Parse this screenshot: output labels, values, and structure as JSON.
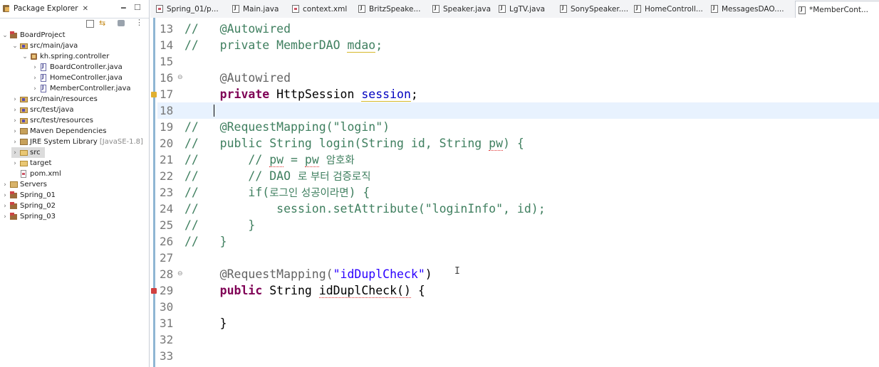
{
  "package_explorer": {
    "title": "Package Explorer",
    "tree": [
      {
        "label": "BoardProject"
      },
      {
        "label": "src/main/java"
      },
      {
        "label": "kh.spring.controller"
      },
      {
        "label": "BoardController.java"
      },
      {
        "label": "HomeController.java"
      },
      {
        "label": "MemberController.java"
      },
      {
        "label": "src/main/resources"
      },
      {
        "label": "src/test/java"
      },
      {
        "label": "src/test/resources"
      },
      {
        "label": "Maven Dependencies"
      },
      {
        "label": "JRE System Library",
        "extra": "[JavaSE-1.8]"
      },
      {
        "label": "src"
      },
      {
        "label": "target"
      },
      {
        "label": "pom.xml"
      },
      {
        "label": "Servers"
      },
      {
        "label": "Spring_01"
      },
      {
        "label": "Spring_02"
      },
      {
        "label": "Spring_03"
      }
    ]
  },
  "editor_tabs": [
    {
      "label": "Spring_01/p..."
    },
    {
      "label": "Main.java"
    },
    {
      "label": "context.xml"
    },
    {
      "label": "BritzSpeake..."
    },
    {
      "label": "Speaker.java"
    },
    {
      "label": "LgTV.java"
    },
    {
      "label": "SonySpeaker...."
    },
    {
      "label": "HomeControll..."
    },
    {
      "label": "MessagesDAO...."
    },
    {
      "label": "*MemberCont..."
    }
  ],
  "editor": {
    "lines": [
      {
        "n": "13",
        "segs": [
          {
            "t": "//   @Autowired",
            "c": "comment"
          }
        ]
      },
      {
        "n": "14",
        "segs": [
          {
            "t": "//   private MemberDAO ",
            "c": "comment"
          },
          {
            "t": "mdao",
            "c": "comment warn"
          },
          {
            "t": ";",
            "c": "comment"
          }
        ]
      },
      {
        "n": "15",
        "segs": []
      },
      {
        "n": "16",
        "segs": [
          {
            "t": "     @Autowired",
            "c": "anno"
          }
        ]
      },
      {
        "n": "17",
        "segs": [
          {
            "t": "     ",
            "c": ""
          },
          {
            "t": "private",
            "c": "kw"
          },
          {
            "t": " HttpSession ",
            "c": ""
          },
          {
            "t": "session",
            "c": "field warn"
          },
          {
            "t": ";",
            "c": ""
          }
        ]
      },
      {
        "n": "18",
        "segs": []
      },
      {
        "n": "19",
        "segs": [
          {
            "t": "//   @RequestMapping(\"login\")",
            "c": "comment"
          }
        ]
      },
      {
        "n": "20",
        "segs": [
          {
            "t": "//   public String login(String id, String ",
            "c": "comment"
          },
          {
            "t": "pw",
            "c": "comment err"
          },
          {
            "t": ") {",
            "c": "comment"
          }
        ]
      },
      {
        "n": "21",
        "segs": [
          {
            "t": "//       // ",
            "c": "comment"
          },
          {
            "t": "pw",
            "c": "comment err"
          },
          {
            "t": " = ",
            "c": "comment"
          },
          {
            "t": "pw",
            "c": "comment err"
          },
          {
            "t": " ",
            "c": "comment"
          },
          {
            "t": "암호화",
            "c": "comment kor"
          }
        ]
      },
      {
        "n": "22",
        "segs": [
          {
            "t": "//       // DAO ",
            "c": "comment"
          },
          {
            "t": "로 부터 검증로직",
            "c": "comment kor"
          }
        ]
      },
      {
        "n": "23",
        "segs": [
          {
            "t": "//       if(",
            "c": "comment"
          },
          {
            "t": "로그인 성공이라면",
            "c": "comment kor"
          },
          {
            "t": ") {",
            "c": "comment"
          }
        ]
      },
      {
        "n": "24",
        "segs": [
          {
            "t": "//           session.setAttribute(\"loginInfo\", id);",
            "c": "comment"
          }
        ]
      },
      {
        "n": "25",
        "segs": [
          {
            "t": "//       }",
            "c": "comment"
          }
        ]
      },
      {
        "n": "26",
        "segs": [
          {
            "t": "//   }",
            "c": "comment"
          }
        ]
      },
      {
        "n": "27",
        "segs": []
      },
      {
        "n": "28",
        "segs": [
          {
            "t": "     @RequestMapping(",
            "c": "anno"
          },
          {
            "t": "\"idDuplCheck\"",
            "c": "str"
          },
          {
            "t": ")",
            "c": ""
          }
        ]
      },
      {
        "n": "29",
        "segs": [
          {
            "t": "     ",
            "c": ""
          },
          {
            "t": "public",
            "c": "kw"
          },
          {
            "t": " String ",
            "c": ""
          },
          {
            "t": "idDuplCheck()",
            "c": "err"
          },
          {
            "t": " {",
            "c": ""
          }
        ]
      },
      {
        "n": "30",
        "segs": []
      },
      {
        "n": "31",
        "segs": [
          {
            "t": "     }",
            "c": ""
          }
        ]
      },
      {
        "n": "32",
        "segs": []
      },
      {
        "n": "33",
        "segs": []
      }
    ]
  },
  "colors": {
    "comment": "#3f7f5f",
    "keyword": "#7f0055",
    "string": "#2a00ff",
    "field": "#0000c0",
    "current_line": "#e8f2fe"
  }
}
